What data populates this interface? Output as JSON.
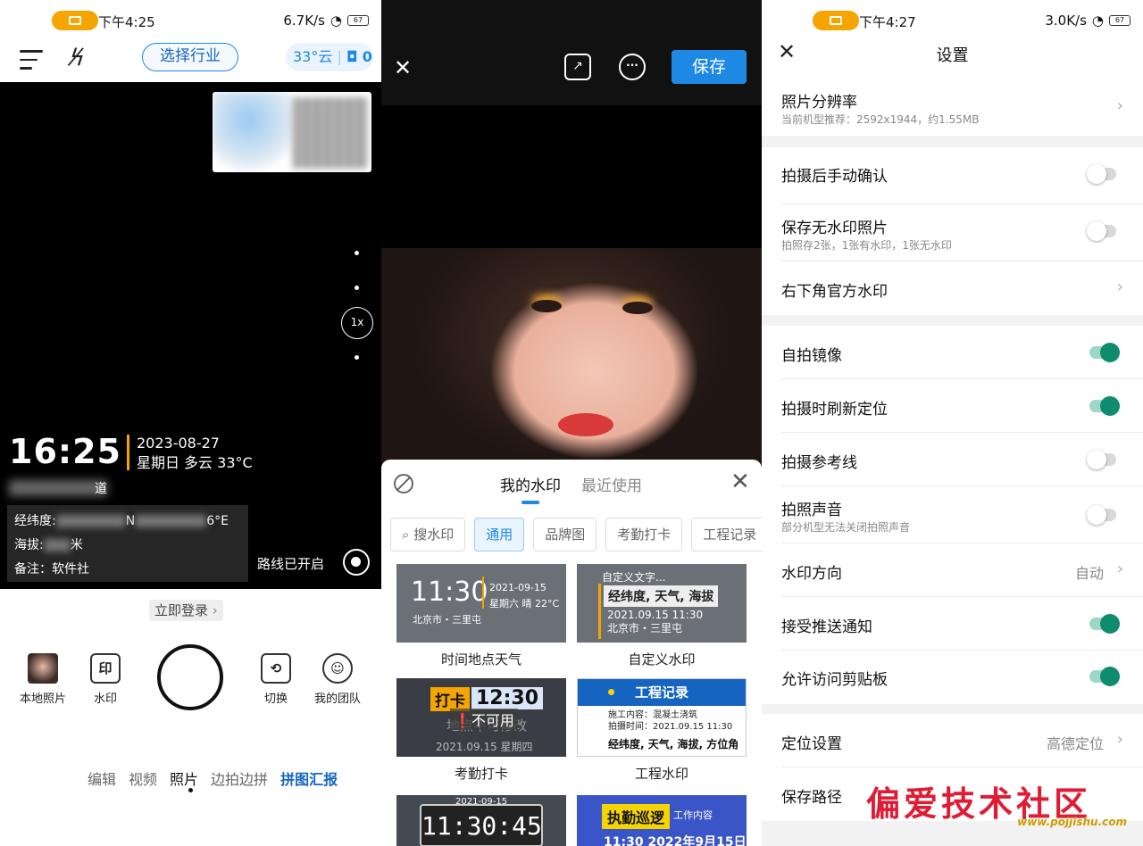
{
  "left": {
    "status": {
      "time": "下午4:25",
      "speed": "6.7K/s",
      "battery": "67"
    },
    "toolbar": {
      "industry": "选择行业",
      "weather": "33°云",
      "count": "0"
    },
    "camera": {
      "zoom": "1x",
      "time": "16:25",
      "date": "2023-08-27",
      "day_weather": "星期日 多云 33°C",
      "road_suffix": "道",
      "lat_label": "经纬度:",
      "lat_suffix": "6°E",
      "lat_mid": "N",
      "alt_label": "海拔:",
      "alt_suffix": "米",
      "note": "备注：软件社",
      "route": "路线已开启"
    },
    "login": "立即登录",
    "bottom": {
      "local": "本地照片",
      "watermark": "水印",
      "watermark_icon": "印",
      "switch": "切换",
      "team": "我的团队"
    },
    "modes": [
      "编辑",
      "视频",
      "照片",
      "边拍边拼",
      "拼图汇报"
    ]
  },
  "middle": {
    "save": "保存",
    "tabs": [
      "我的水印",
      "最近使用"
    ],
    "chips": [
      "搜水印",
      "通用",
      "品牌图",
      "考勤打卡",
      "工程记录"
    ],
    "cards": [
      {
        "caption": "时间地点天气",
        "time": "11:30",
        "date": "2021-09-15",
        "sub": "星期六 晴 22°C",
        "place": "北京市・三里屯"
      },
      {
        "caption": "自定义水印",
        "l1": "自定义文字...",
        "l2": "经纬度, 天气, 海拔",
        "l3": "2021.09.15  11:30",
        "l4": "北京市・三里屯"
      },
      {
        "caption": "考勤打卡",
        "tag": "打卡",
        "time": "12:30",
        "na": "不可用",
        "under": "地点不可修改",
        "date": "2021.09.15  星期四"
      },
      {
        "caption": "工程水印",
        "head": "工程记录",
        "l1": "施工内容：混凝土浇筑",
        "l2": "拍摄时间：2021.09.15 11:30",
        "l3": "经纬度, 天气, 海拔, 方位角"
      },
      {
        "digital": "11:30:45",
        "date": "2021-09-15"
      },
      {
        "tag": "执勤巡逻",
        "sub": "工作内容",
        "line": "11:30  2022年9月15日"
      }
    ]
  },
  "right": {
    "status": {
      "time": "下午4:27",
      "speed": "3.0K/s",
      "battery": "67"
    },
    "title": "设置",
    "rows": [
      {
        "label": "照片分辨率",
        "sub": "当前机型推荐：2592x1944，约1.55MB"
      },
      {
        "label": "拍摄后手动确认",
        "toggle": false
      },
      {
        "label": "保存无水印照片",
        "sub": "拍照存2张，1张有水印，1张无水印",
        "toggle": false
      },
      {
        "label": "右下角官方水印"
      },
      {
        "label": "自拍镜像",
        "toggle": true
      },
      {
        "label": "拍摄时刷新定位",
        "toggle": true
      },
      {
        "label": "拍摄参考线",
        "toggle": false
      },
      {
        "label": "拍照声音",
        "sub": "部分机型无法关闭拍照声音",
        "toggle": false
      },
      {
        "label": "水印方向",
        "value": "自动"
      },
      {
        "label": "接受推送通知",
        "toggle": true
      },
      {
        "label": "允许访问剪贴板",
        "toggle": true
      },
      {
        "label": "定位设置",
        "value": "高德定位"
      },
      {
        "label": "保存路径"
      }
    ],
    "brand": {
      "name": "偏爱技术社区",
      "url": "www.pojjishu.com"
    }
  }
}
